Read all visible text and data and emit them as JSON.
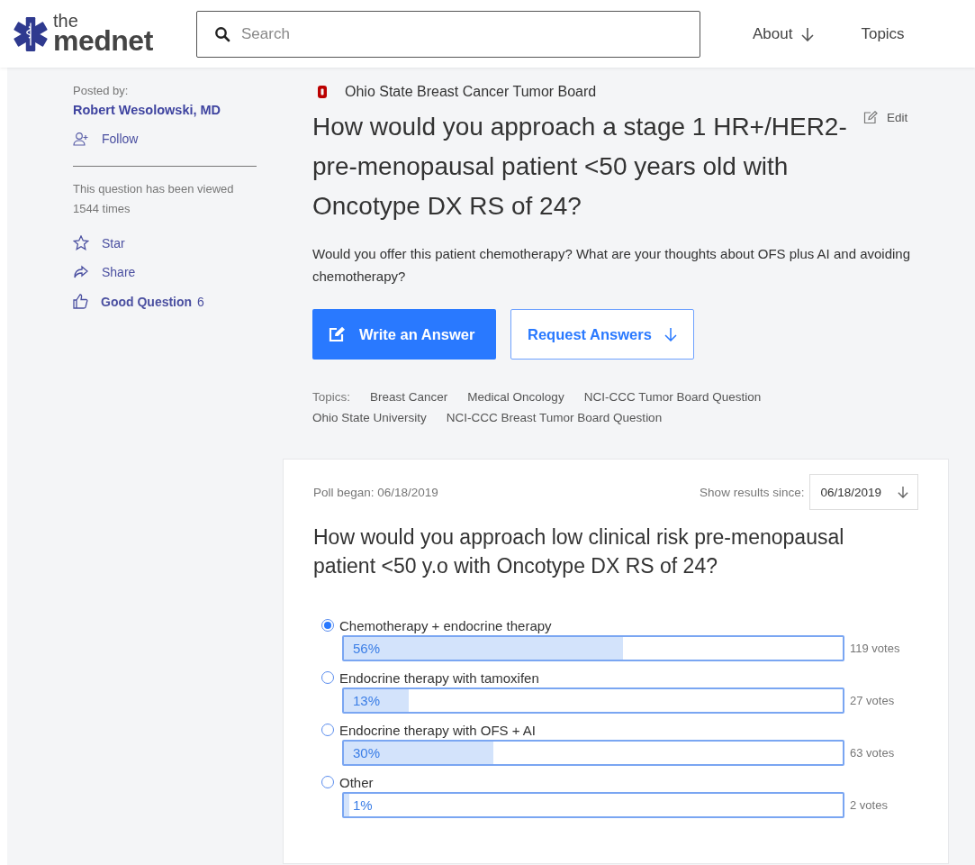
{
  "logo": {
    "small": "the",
    "big": "mednet"
  },
  "search": {
    "placeholder": "Search"
  },
  "nav": [
    {
      "label": "About",
      "dropdown": true
    },
    {
      "label": "Topics",
      "dropdown": false
    }
  ],
  "sidebar": {
    "posted_label": "Posted by:",
    "author": "Robert Wesolowski, MD",
    "follow": "Follow",
    "views": "This question has been viewed 1544 times",
    "actions": [
      {
        "kind": "star",
        "label": "Star"
      },
      {
        "kind": "share",
        "label": "Share"
      },
      {
        "kind": "like",
        "label": "Good Question",
        "count": "6"
      }
    ]
  },
  "question": {
    "board": "Ohio State Breast Cancer Tumor Board",
    "title": "How would you approach a stage 1 HR+/HER2- pre-menopausal patient <50 years old with Oncotype DX RS of 24?",
    "edit": "Edit",
    "body": "Would you offer this patient chemotherapy? What are your thoughts about OFS plus AI and avoiding chemotherapy?",
    "buttons": [
      {
        "kind": "primary",
        "label": "Write an Answer"
      },
      {
        "kind": "outline",
        "label": "Request Answers"
      }
    ],
    "topics_label": "Topics:",
    "topics": [
      "Breast Cancer",
      "Medical Oncology",
      "NCI-CCC Tumor Board Question",
      "Ohio State University",
      "NCI-CCC Breast Tumor Board Question"
    ]
  },
  "poll": {
    "began": "Poll began: 06/18/2019",
    "since_label": "Show results since:",
    "since_value": "06/18/2019",
    "question": "How would you approach low clinical risk pre-menopausal patient <50 y.o with Oncotype DX RS of 24?",
    "options": [
      {
        "label": "Chemotherapy + endocrine therapy",
        "selected": true,
        "level": 0.56,
        "percent": "56%",
        "votes": "119 votes"
      },
      {
        "label": "Endocrine therapy with tamoxifen",
        "selected": false,
        "level": 0.13,
        "percent": "13%",
        "votes": "27 votes"
      },
      {
        "label": "Endocrine therapy with OFS + AI",
        "selected": false,
        "level": 0.3,
        "percent": "30%",
        "votes": "63 votes"
      },
      {
        "label": "Other",
        "selected": false,
        "level": 0.01,
        "percent": "1%",
        "votes": "2 votes"
      }
    ]
  }
}
